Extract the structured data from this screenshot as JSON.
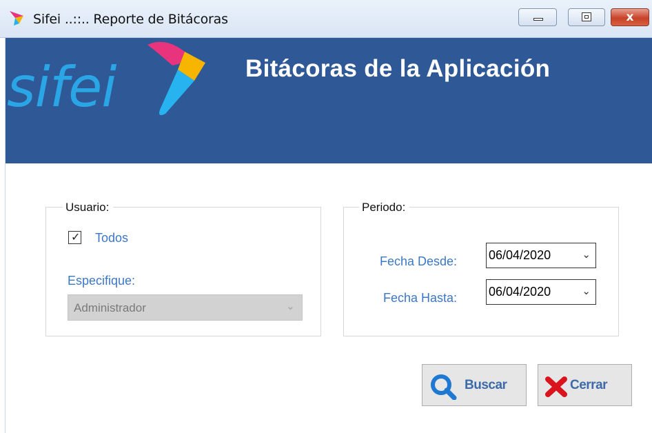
{
  "window": {
    "title": "Sifei ..::.. Reporte de Bitácoras",
    "minimize_icon": "minimize-icon",
    "maximize_icon": "maximize-icon",
    "close_icon": "close-icon",
    "close_glyph": "x"
  },
  "banner": {
    "logo_text": "sifei",
    "title": "Bitácoras de la Aplicación",
    "background_color": "#2f5896"
  },
  "usuario": {
    "legend": "Usuario:",
    "todos_label": "Todos",
    "todos_checked": true,
    "especifique_label": "Especifique:",
    "user_select_value": "Administrador",
    "user_select_enabled": false
  },
  "periodo": {
    "legend": "Periodo:",
    "fecha_desde_label": "Fecha Desde:",
    "fecha_desde_value": "06/04/2020",
    "fecha_hasta_label": "Fecha Hasta:",
    "fecha_hasta_value": "06/04/2020"
  },
  "actions": {
    "buscar_label": "Buscar",
    "buscar_icon": "search-icon",
    "cerrar_label": "Cerrar",
    "cerrar_icon": "close-x-icon"
  }
}
